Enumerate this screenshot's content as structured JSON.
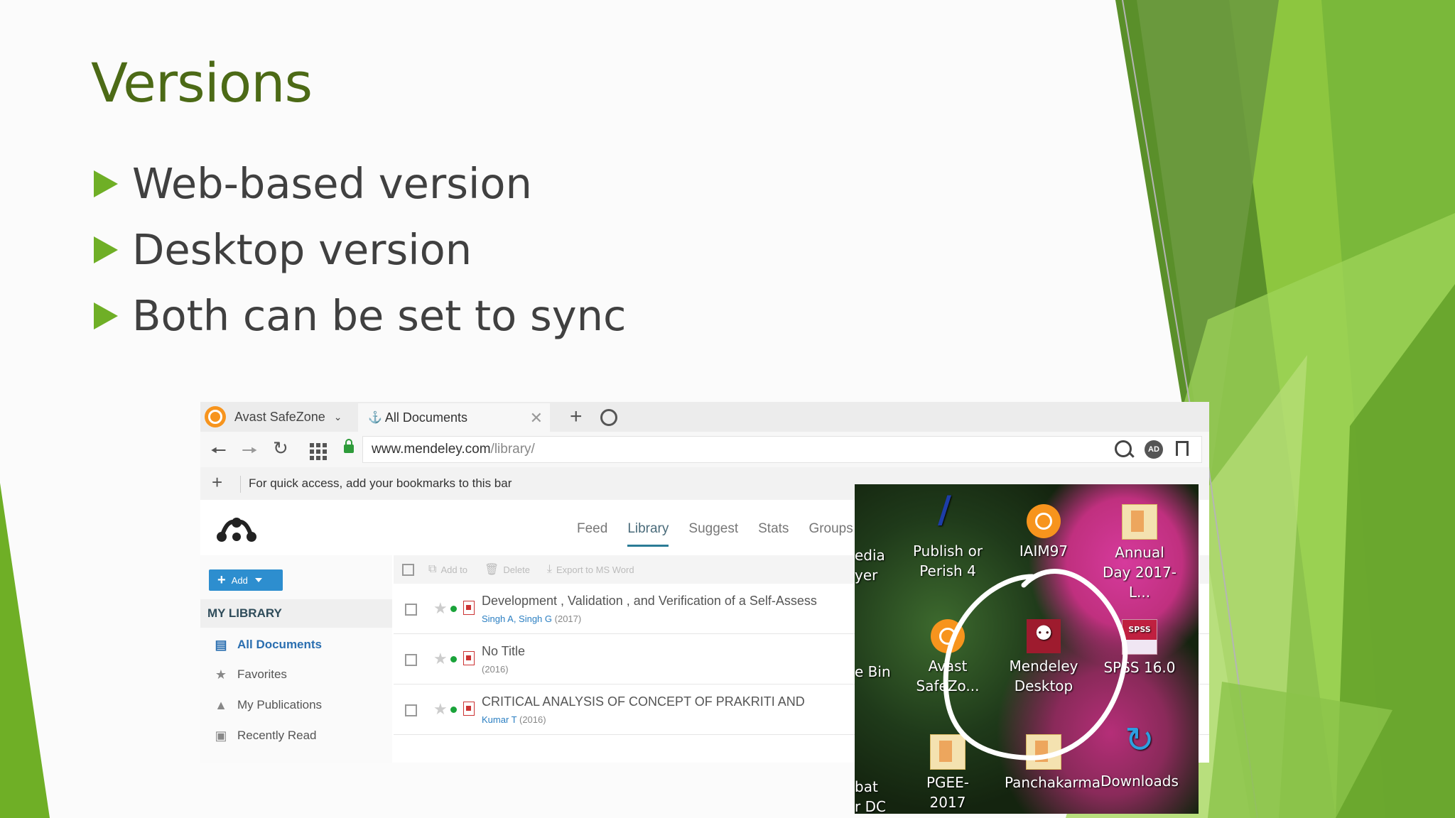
{
  "slide": {
    "title": "Versions",
    "bullets": [
      "Web-based version",
      "Desktop version",
      "Both can be set to sync"
    ],
    "colors": {
      "title": "#4c6a16",
      "bullet_marker": "#6faf26",
      "deco_green": "#6faf26"
    }
  },
  "browser": {
    "tab1_label": "Avast SafeZone",
    "tab2_label": "All Documents",
    "url_host": "www.mendeley.com",
    "url_path": "/library/",
    "bookmarks_message": "For quick access, add your bookmarks to this bar",
    "adblock_label": "AD"
  },
  "mendeley": {
    "nav": [
      "Feed",
      "Library",
      "Suggest",
      "Stats",
      "Groups"
    ],
    "active_nav": "Library",
    "add_button": "Add",
    "my_library": "MY LIBRARY",
    "sidebar_items": [
      {
        "label": "All Documents",
        "icon": "documents-icon"
      },
      {
        "label": "Favorites",
        "icon": "star-icon"
      },
      {
        "label": "My Publications",
        "icon": "graduation-cap-icon"
      },
      {
        "label": "Recently Read",
        "icon": "book-icon"
      }
    ],
    "toolbar": {
      "add_to": "Add to",
      "delete": "Delete",
      "export": "Export to MS Word"
    },
    "documents": [
      {
        "title": "Development , Validation , and Verification of a Self-Assess",
        "authors": "Singh A, Singh G",
        "year": "(2017)"
      },
      {
        "title": "No Title",
        "authors": "",
        "year": "(2016)"
      },
      {
        "title": "CRITICAL ANALYSIS OF CONCEPT OF PRAKRITI AND",
        "authors": "Kumar T",
        "year": "(2016)"
      }
    ]
  },
  "desktop": {
    "icons": [
      {
        "name": "publish-or-perish-icon",
        "label_lines": [
          "Publish or",
          "Perish 4"
        ]
      },
      {
        "name": "iaim97-icon",
        "label_lines": [
          "IAIM97"
        ]
      },
      {
        "name": "annual-day-icon",
        "label_lines": [
          "Annual",
          "Day 2017-L..."
        ]
      },
      {
        "name": "avast-safezone-icon",
        "label_lines": [
          "Avast",
          "SafeZo..."
        ]
      },
      {
        "name": "mendeley-desktop-icon",
        "label_lines": [
          "Mendeley",
          "Desktop"
        ]
      },
      {
        "name": "spss-icon",
        "label_lines": [
          "SPSS 16.0"
        ]
      },
      {
        "name": "pgee-icon",
        "label_lines": [
          "PGEE-2017"
        ]
      },
      {
        "name": "panchakarma-icon",
        "label_lines": [
          "Panchakarma"
        ]
      },
      {
        "name": "downloads-icon",
        "label_lines": [
          "Downloads"
        ]
      }
    ],
    "partial_labels": [
      "edia",
      "yer",
      "e Bin",
      "bat",
      "r DC"
    ]
  }
}
